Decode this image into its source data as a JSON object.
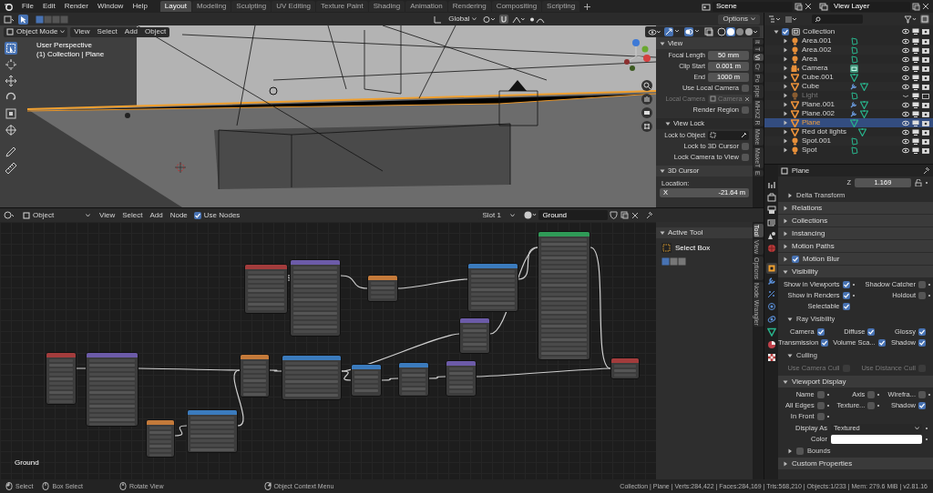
{
  "top_bar": {
    "menu": [
      "File",
      "Edit",
      "Render",
      "Window",
      "Help"
    ],
    "workspaces": [
      {
        "label": "Layout",
        "selected": true
      },
      {
        "label": "Modeling",
        "selected": false
      },
      {
        "label": "Sculpting",
        "selected": false
      },
      {
        "label": "UV Editing",
        "selected": false
      },
      {
        "label": "Texture Paint",
        "selected": false
      },
      {
        "label": "Shading",
        "selected": false
      },
      {
        "label": "Animation",
        "selected": false
      },
      {
        "label": "Rendering",
        "selected": false
      },
      {
        "label": "Compositing",
        "selected": false
      },
      {
        "label": "Scripting",
        "selected": false
      }
    ],
    "scene": "Scene",
    "view_layer": "View Layer"
  },
  "viewport": {
    "orientation": "Global",
    "options": "Options",
    "mode": "Object Mode",
    "menus": [
      "View",
      "Select",
      "Add",
      "Object"
    ],
    "overlay_text": [
      "User Perspective",
      "(1) Collection | Plane"
    ],
    "sidebar": {
      "tabs": [
        {
          "label": "It",
          "selected": false
        },
        {
          "label": "T",
          "selected": false
        },
        {
          "label": "Vi",
          "selected": true
        },
        {
          "label": "Cr",
          "selected": false
        },
        {
          "label": "Po",
          "selected": false
        },
        {
          "label": "pipe",
          "selected": false
        },
        {
          "label": "MHX2 R",
          "selected": false
        },
        {
          "label": "Make",
          "selected": false
        },
        {
          "label": "MakeT",
          "selected": false
        },
        {
          "label": "E",
          "selected": false
        }
      ],
      "view_panel": {
        "title": "View",
        "fields": [
          {
            "label": "Focal Length",
            "value": "50 mm"
          },
          {
            "label": "Clip Start",
            "value": "0.001 m"
          },
          {
            "label": "End",
            "value": "1000 m"
          }
        ],
        "use_local_camera": {
          "label": "Use Local Camera",
          "checked": false
        },
        "local_camera": {
          "label": "Local Camera",
          "value": "Camera",
          "disabled": true
        },
        "render_region": {
          "label": "Render Region",
          "checked": false
        }
      },
      "view_lock": {
        "title": "View Lock",
        "lock_to_object": "Lock to Object",
        "checks": [
          {
            "label": "Lock to 3D Cursor",
            "checked": false
          },
          {
            "label": "Lock Camera to View",
            "checked": false
          }
        ]
      },
      "cursor_panel": {
        "title": "3D Cursor",
        "location_label": "Location:",
        "x_label": "X",
        "x_value": "-21.64 m"
      }
    }
  },
  "node_editor": {
    "object_type": "Object",
    "menus": [
      "View",
      "Select",
      "Add",
      "Node"
    ],
    "use_nodes": {
      "label": "Use Nodes",
      "checked": true
    },
    "slot": "Slot 1",
    "material": "Ground",
    "canvas_label": "Ground",
    "nodes": [
      {
        "color": "#a33c3c"
      },
      {
        "color": "#6c5ba8"
      },
      {
        "color": "#c47a3a"
      },
      {
        "color": "#3b7bbd"
      },
      {
        "color": "#2f9a57"
      },
      {
        "color": "#6c5ba8"
      },
      {
        "color": "#a33c3c"
      },
      {
        "color": "#6c5ba8"
      },
      {
        "color": "#c47a3a"
      },
      {
        "color": "#3b7bbd"
      },
      {
        "color": "#c47a3a"
      },
      {
        "color": "#3b7bbd"
      },
      {
        "color": "#3b7bbd"
      },
      {
        "color": "#3b7bbd"
      },
      {
        "color": "#6c5ba8"
      },
      {
        "color": "#a33c3c"
      }
    ],
    "tool_panel": {
      "title": "Active Tool",
      "tool": "Select Box"
    },
    "tabs": [
      {
        "label": "Tool",
        "selected": true
      },
      {
        "label": "View",
        "selected": false
      },
      {
        "label": "Options",
        "selected": false
      },
      {
        "label": "Node Wrangler",
        "selected": false
      }
    ]
  },
  "outliner": {
    "collection": {
      "name": "Collection",
      "checked": true,
      "expanded": true,
      "children": [
        {
          "name": "Area.001",
          "kind": "light",
          "selected": false,
          "hidden": false,
          "expanded": false,
          "modifier": false
        },
        {
          "name": "Area.002",
          "kind": "light",
          "selected": false,
          "hidden": false,
          "expanded": false,
          "modifier": false
        },
        {
          "name": "Area",
          "kind": "light",
          "selected": false,
          "hidden": false,
          "expanded": false,
          "modifier": false
        },
        {
          "name": "Camera",
          "kind": "camera",
          "selected": false,
          "hidden": false,
          "expanded": false,
          "modifier": false
        },
        {
          "name": "Cube.001",
          "kind": "mesh",
          "selected": false,
          "hidden": false,
          "expanded": false,
          "modifier": false
        },
        {
          "name": "Cube",
          "kind": "mesh",
          "selected": false,
          "hidden": false,
          "expanded": false,
          "modifier": true
        },
        {
          "name": "Light",
          "kind": "light",
          "selected": false,
          "hidden": true,
          "expanded": false,
          "modifier": false
        },
        {
          "name": "Plane.001",
          "kind": "mesh",
          "selected": false,
          "hidden": false,
          "expanded": false,
          "modifier": true
        },
        {
          "name": "Plane.002",
          "kind": "mesh",
          "selected": false,
          "hidden": false,
          "expanded": false,
          "modifier": true
        },
        {
          "name": "Plane",
          "kind": "mesh",
          "selected": true,
          "hidden": false,
          "expanded": false,
          "modifier": false
        },
        {
          "name": "Red dot lights",
          "kind": "mesh",
          "selected": false,
          "hidden": false,
          "expanded": false,
          "modifier": false
        },
        {
          "name": "Spot.001",
          "kind": "light",
          "selected": false,
          "hidden": false,
          "expanded": false,
          "modifier": false
        },
        {
          "name": "Spot",
          "kind": "light",
          "selected": false,
          "hidden": false,
          "expanded": false,
          "modifier": false
        }
      ]
    }
  },
  "properties": {
    "object_name": "Plane",
    "tabs": [
      {
        "selected": false
      },
      {
        "selected": false
      },
      {
        "selected": false
      },
      {
        "selected": false
      },
      {
        "selected": false
      },
      {
        "selected": false
      },
      {
        "selected": true
      },
      {
        "selected": false
      },
      {
        "selected": false
      },
      {
        "selected": false
      },
      {
        "selected": false
      },
      {
        "selected": false
      },
      {
        "selected": false
      },
      {
        "selected": false
      }
    ],
    "z_field": {
      "label": "Z",
      "value": "1.169"
    },
    "sections": [
      {
        "kind": "header",
        "title": "Delta Transform",
        "sub": true,
        "expanded": false
      },
      {
        "kind": "header",
        "title": "Relations",
        "sub": false,
        "expanded": false
      },
      {
        "kind": "header",
        "title": "Collections",
        "sub": false,
        "expanded": false
      },
      {
        "kind": "header",
        "title": "Instancing",
        "sub": false,
        "expanded": false
      },
      {
        "kind": "header",
        "title": "Motion Paths",
        "sub": false,
        "expanded": false
      },
      {
        "kind": "header",
        "title": "Motion Blur",
        "sub": false,
        "expanded": false,
        "checked": true
      },
      {
        "kind": "header",
        "title": "Visibility",
        "sub": false,
        "expanded": true
      },
      {
        "kind": "checks",
        "rows": [
          [
            {
              "label": "Show in Viewports",
              "checked": true,
              "keyframe": true
            },
            {
              "label": "Shadow Catcher",
              "checked": false,
              "keyframe": true
            }
          ],
          [
            {
              "label": "Show in Renders",
              "checked": true,
              "keyframe": true
            },
            {
              "label": "Holdout",
              "checked": false,
              "keyframe": true
            }
          ],
          [
            {
              "label": "Selectable",
              "checked": true,
              "keyframe": false
            }
          ]
        ]
      },
      {
        "kind": "header",
        "title": "Ray Visibility",
        "sub": true,
        "expanded": true
      },
      {
        "kind": "checks",
        "rows": [
          [
            {
              "label": "Camera",
              "checked": true,
              "keyframe": false
            },
            {
              "label": "Diffuse",
              "checked": true,
              "keyframe": false
            },
            {
              "label": "Glossy",
              "checked": true,
              "keyframe": false
            }
          ],
          [
            {
              "label": "Transmission",
              "checked": true,
              "keyframe": false
            },
            {
              "label": "Volume Sca...",
              "checked": true,
              "keyframe": false
            },
            {
              "label": "Shadow",
              "checked": true,
              "keyframe": false
            }
          ]
        ]
      },
      {
        "kind": "header",
        "title": "Culling",
        "sub": true,
        "expanded": true
      },
      {
        "kind": "checks",
        "rows": [
          [
            {
              "label": "Use Camera Cull",
              "checked": false,
              "keyframe": false,
              "disabled": true
            },
            {
              "label": "Use Distance Cull",
              "checked": false,
              "keyframe": false,
              "disabled": true
            }
          ]
        ]
      },
      {
        "kind": "header",
        "title": "Viewport Display",
        "sub": false,
        "expanded": true
      },
      {
        "kind": "checks",
        "rows": [
          [
            {
              "label": "Name",
              "checked": false,
              "keyframe": true
            },
            {
              "label": "Axis",
              "checked": false,
              "keyframe": true
            },
            {
              "label": "Wirefra...",
              "checked": false,
              "keyframe": true
            }
          ],
          [
            {
              "label": "All Edges",
              "checked": false,
              "keyframe": true
            },
            {
              "label": "Texture...",
              "checked": false,
              "keyframe": true
            },
            {
              "label": "Shadow",
              "checked": true,
              "keyframe": false
            }
          ],
          [
            {
              "label": "In Front",
              "checked": false,
              "keyframe": true
            }
          ]
        ]
      },
      {
        "kind": "dropdown",
        "label": "Display As",
        "value": "Textured"
      },
      {
        "kind": "color",
        "label": "Color",
        "color": "#ffffff"
      },
      {
        "kind": "header",
        "title": "Bounds",
        "sub": true,
        "expanded": false,
        "checked": false
      },
      {
        "kind": "header",
        "title": "Custom Properties",
        "sub": false,
        "expanded": false
      }
    ]
  },
  "status_bar": {
    "hints": [
      "Select",
      "Box Select",
      "Rotate View",
      "Object Context Menu"
    ],
    "stats": "Collection | Plane | Verts:284,422 | Faces:284,169 | Tris:568,210 | Objects:1/233 | Mem: 279.6 MiB | v2.81.16"
  }
}
